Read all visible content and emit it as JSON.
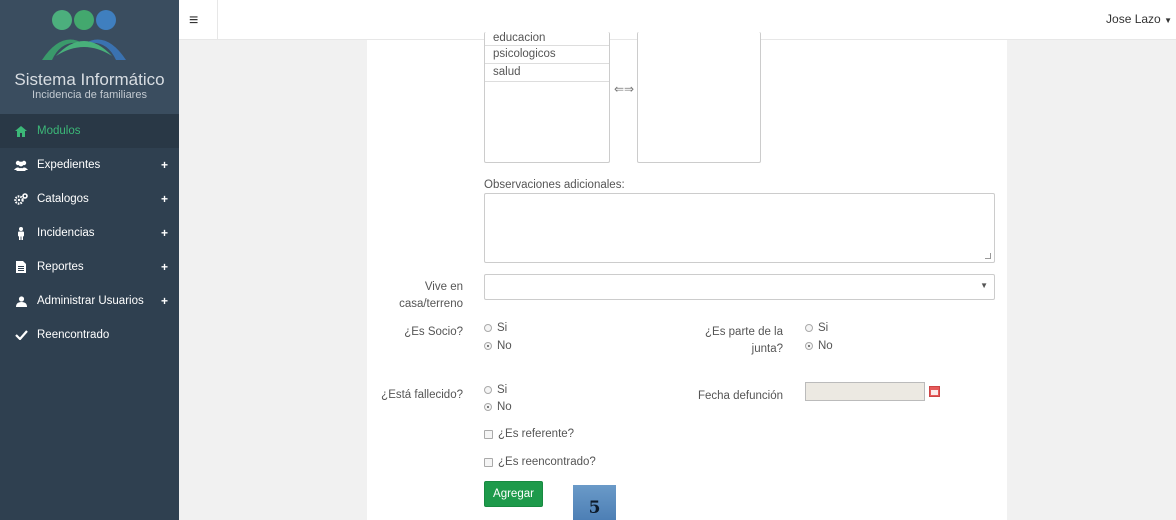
{
  "brand": {
    "title": "Sistema Informático",
    "subtitle": "Incidencia de familiares"
  },
  "sidebar": {
    "items": [
      {
        "label": "Modulos",
        "icon": "home-icon",
        "active": true
      },
      {
        "label": "Expedientes",
        "icon": "users-icon",
        "plus": "+"
      },
      {
        "label": "Catalogos",
        "icon": "cogs-icon",
        "plus": "+"
      },
      {
        "label": "Incidencias",
        "icon": "person-icon",
        "plus": "+"
      },
      {
        "label": "Reportes",
        "icon": "file-icon",
        "plus": "+"
      },
      {
        "label": "Administrar Usuarios",
        "icon": "user-icon",
        "plus": "+"
      },
      {
        "label": "Reencontrado",
        "icon": "check-icon"
      }
    ]
  },
  "topbar": {
    "menu_icon": "≡",
    "user": "Jose Lazo"
  },
  "form": {
    "available_list": [
      "educacion",
      "psicologicos",
      "salud"
    ],
    "swap_icon": "⇐⇒",
    "observaciones_label": "Observaciones adicionales:",
    "observaciones_value": "",
    "vive_label_1": "Vive en",
    "vive_label_2": "casa/terreno",
    "vive_value": "",
    "socio_label": "¿Es Socio?",
    "socio_si": "Si",
    "socio_no": "No",
    "junta_label_1": "¿Es parte de la",
    "junta_label_2": "junta?",
    "junta_si": "Si",
    "junta_no": "No",
    "fallecido_label": "¿Está fallecido?",
    "fallecido_si": "Si",
    "fallecido_no": "No",
    "fecha_label": "Fecha defunción",
    "fecha_value": "",
    "referente_label": "¿Es referente?",
    "reencontrado_label": "¿Es reencontrado?",
    "agregar_label": "Agregar"
  },
  "overlay_badge": "5",
  "colors": {
    "sidebar_bg": "#2f4050",
    "active_text": "#3cb878",
    "button_green": "#1e9a4b"
  }
}
